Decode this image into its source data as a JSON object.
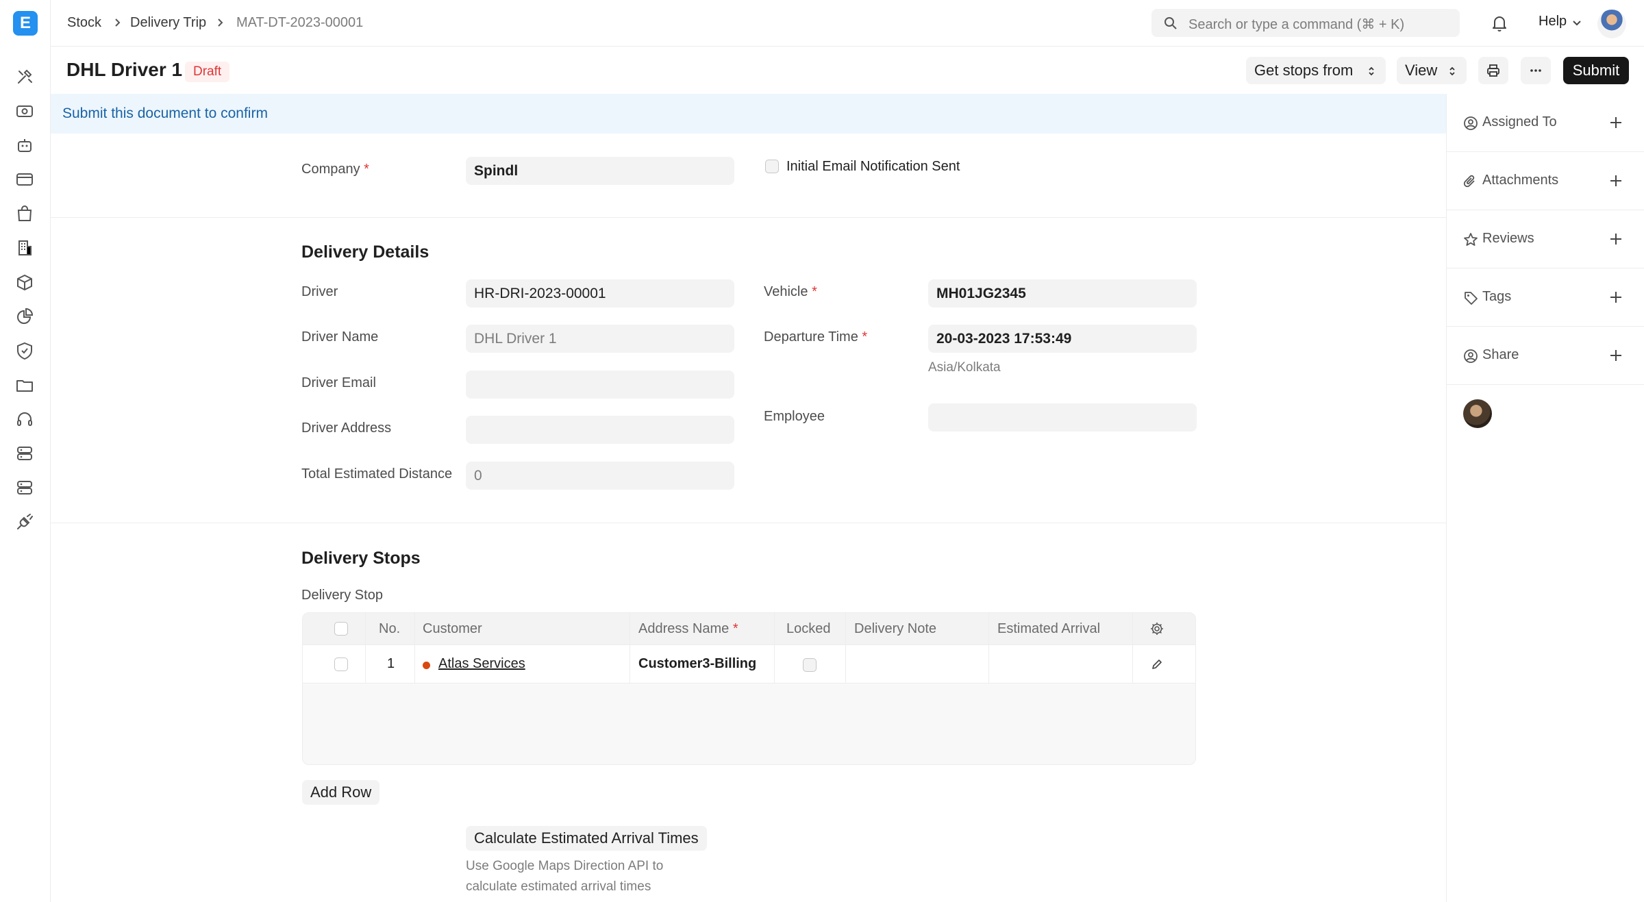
{
  "app": {
    "logo_letter": "E"
  },
  "breadcrumb": [
    "Stock",
    "Delivery Trip",
    "MAT-DT-2023-00001"
  ],
  "search": {
    "placeholder": "Search or type a command (⌘ + K)"
  },
  "topbar": {
    "help_label": "Help"
  },
  "document": {
    "title": "DHL Driver 1",
    "status": "Draft",
    "actions": {
      "get_stops": "Get stops from",
      "view": "View",
      "submit": "Submit"
    }
  },
  "alert": {
    "text": "Submit this document to confirm"
  },
  "sidebar": {
    "items": [
      {
        "label": "Assigned To",
        "icon": "assign-icon"
      },
      {
        "label": "Attachments",
        "icon": "paperclip-icon"
      },
      {
        "label": "Reviews",
        "icon": "star-icon"
      },
      {
        "label": "Tags",
        "icon": "tag-icon"
      },
      {
        "label": "Share",
        "icon": "share-icon"
      }
    ]
  },
  "form": {
    "company": {
      "label": "Company",
      "value": "Spindl"
    },
    "initial_email": {
      "label": "Initial Email Notification Sent",
      "checked": false
    },
    "delivery_details": {
      "title": "Delivery Details",
      "driver": {
        "label": "Driver",
        "value": "HR-DRI-2023-00001"
      },
      "driver_name": {
        "label": "Driver Name",
        "value": "DHL Driver 1"
      },
      "driver_email": {
        "label": "Driver Email",
        "value": ""
      },
      "driver_address": {
        "label": "Driver Address",
        "value": ""
      },
      "total_distance": {
        "label": "Total Estimated Distance",
        "value": "0"
      },
      "vehicle": {
        "label": "Vehicle",
        "value": "MH01JG2345"
      },
      "departure_time": {
        "label": "Departure Time",
        "value": "20-03-2023 17:53:49",
        "timezone": "Asia/Kolkata"
      },
      "employee": {
        "label": "Employee",
        "value": ""
      }
    },
    "delivery_stops": {
      "title": "Delivery Stops",
      "table_label": "Delivery Stop",
      "columns": [
        "No.",
        "Customer",
        "Address Name",
        "Locked",
        "Delivery Note",
        "Estimated Arrival"
      ],
      "rows": [
        {
          "no": "1",
          "customer": "Atlas Services",
          "address_name": "Customer3-Billing",
          "locked": false,
          "delivery_note": "",
          "estimated_arrival": ""
        }
      ],
      "add_row": "Add Row",
      "calc_button": "Calculate Estimated Arrival Times",
      "calc_hint_1": "Use Google Maps Direction API to",
      "calc_hint_2": "calculate estimated arrival times"
    }
  },
  "colors": {
    "brand": "#2490ef",
    "required": "#e03636",
    "status_dot": "#d9480f",
    "alert_bg": "#edf6fd",
    "alert_text": "#1a63a5"
  }
}
